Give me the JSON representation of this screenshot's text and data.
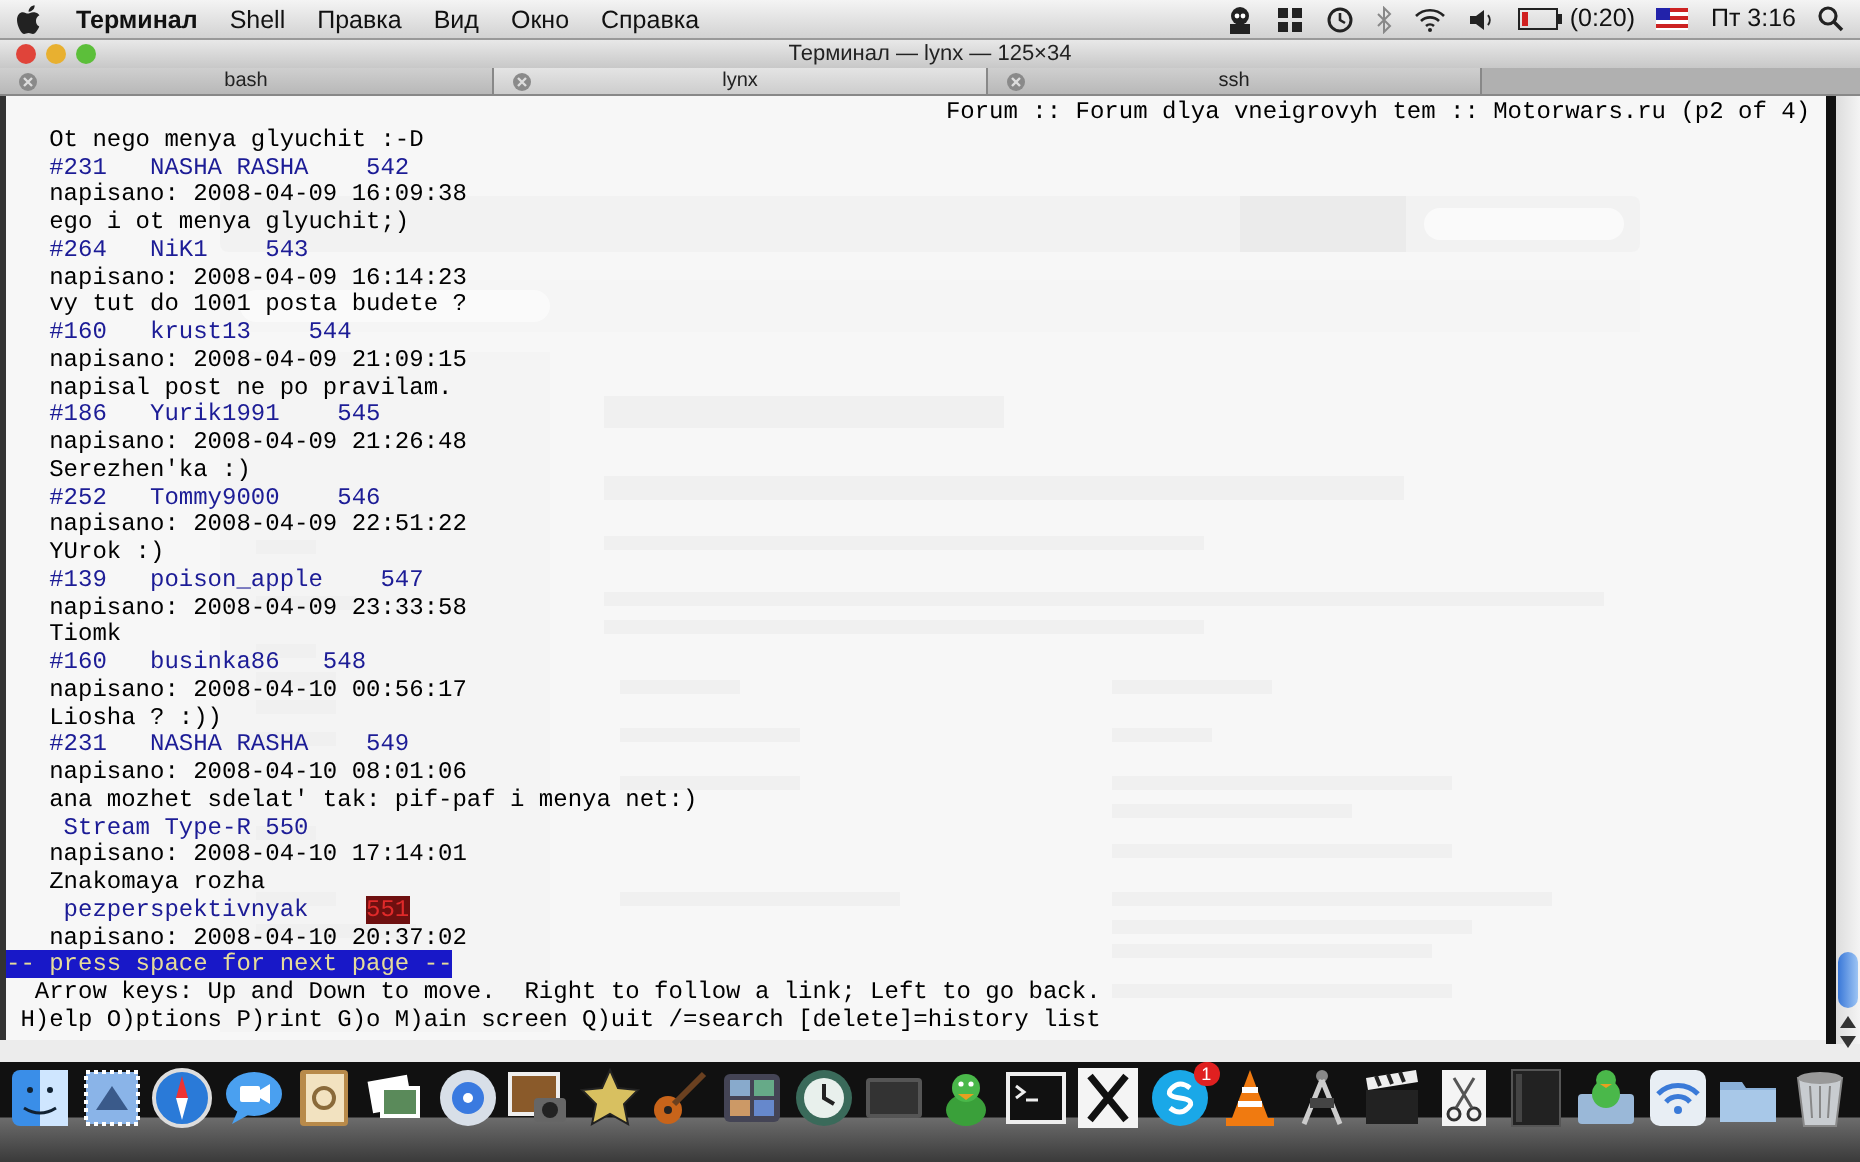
{
  "menu_bar": {
    "app": "Терминал",
    "items": [
      "Shell",
      "Правка",
      "Вид",
      "Окно",
      "Справка"
    ],
    "battery": "(0:20)",
    "clock": "Пт 3:16"
  },
  "window": {
    "title": "Терминал — lynx — 125×34"
  },
  "tabs": [
    {
      "label": "bash",
      "selected": false
    },
    {
      "label": "lynx",
      "selected": true
    },
    {
      "label": "ssh",
      "selected": false
    }
  ],
  "terminal": {
    "page_title": "Forum :: Forum dlya vneigrovyh tem :: Motorwars.ru (p2 of 4)",
    "lines": [
      {
        "kind": "text",
        "text": "Ot nego menya glyuchit :-D"
      },
      {
        "kind": "link",
        "text": "#231   NASHA RASHA    542",
        "selected": false
      },
      {
        "kind": "text",
        "text": "napisano: 2008-04-09 16:09:38"
      },
      {
        "kind": "text",
        "text": "ego i ot menya glyuchit;)"
      },
      {
        "kind": "link",
        "text": "#264   NiK1    543",
        "selected": false
      },
      {
        "kind": "text",
        "text": "napisano: 2008-04-09 16:14:23"
      },
      {
        "kind": "text",
        "text": "vy tut do 1001 posta budete ?"
      },
      {
        "kind": "link",
        "text": "#160   krust13    544",
        "selected": false
      },
      {
        "kind": "text",
        "text": "napisano: 2008-04-09 21:09:15"
      },
      {
        "kind": "text",
        "text": "napisal post ne po pravilam."
      },
      {
        "kind": "link",
        "text": "#186   Yurik1991    545",
        "selected": false
      },
      {
        "kind": "text",
        "text": "napisano: 2008-04-09 21:26:48"
      },
      {
        "kind": "text",
        "text": "Serezhen'ka :)"
      },
      {
        "kind": "link",
        "text": "#252   Tommy9000    546",
        "selected": false
      },
      {
        "kind": "text",
        "text": "napisano: 2008-04-09 22:51:22"
      },
      {
        "kind": "text",
        "text": "YUrok :)"
      },
      {
        "kind": "link",
        "text": "#139   poison_apple    547",
        "selected": false
      },
      {
        "kind": "text",
        "text": "napisano: 2008-04-09 23:33:58"
      },
      {
        "kind": "text",
        "text": "Tiomk"
      },
      {
        "kind": "link",
        "text": "#160   businka86   548",
        "selected": false
      },
      {
        "kind": "text",
        "text": "napisano: 2008-04-10 00:56:17"
      },
      {
        "kind": "text",
        "text": "Liosha ? :))"
      },
      {
        "kind": "link",
        "text": "#231   NASHA RASHA    549",
        "selected": false
      },
      {
        "kind": "text",
        "text": "napisano: 2008-04-10 08:01:06"
      },
      {
        "kind": "text",
        "text": "ana mozhet sdelat' tak: pif-paf i menya net:)"
      },
      {
        "kind": "link",
        "text": " Stream Type-R 550",
        "selected": false
      },
      {
        "kind": "text",
        "text": "napisano: 2008-04-10 17:14:01"
      },
      {
        "kind": "text",
        "text": "Znakomaya rozha"
      },
      {
        "kind": "link",
        "text": " pezperspektivnyak",
        "number": "551",
        "selected": true
      },
      {
        "kind": "text",
        "text": "napisano: 2008-04-10 20:37:02"
      }
    ],
    "prompt": "-- press space for next page --",
    "help_lines": [
      "Arrow keys: Up and Down to move.  Right to follow a link; Left to go back.",
      "H)elp O)ptions P)rint G)o M)ain screen Q)uit /=search [delete]=history list"
    ]
  },
  "dock": {
    "badge": "1"
  }
}
